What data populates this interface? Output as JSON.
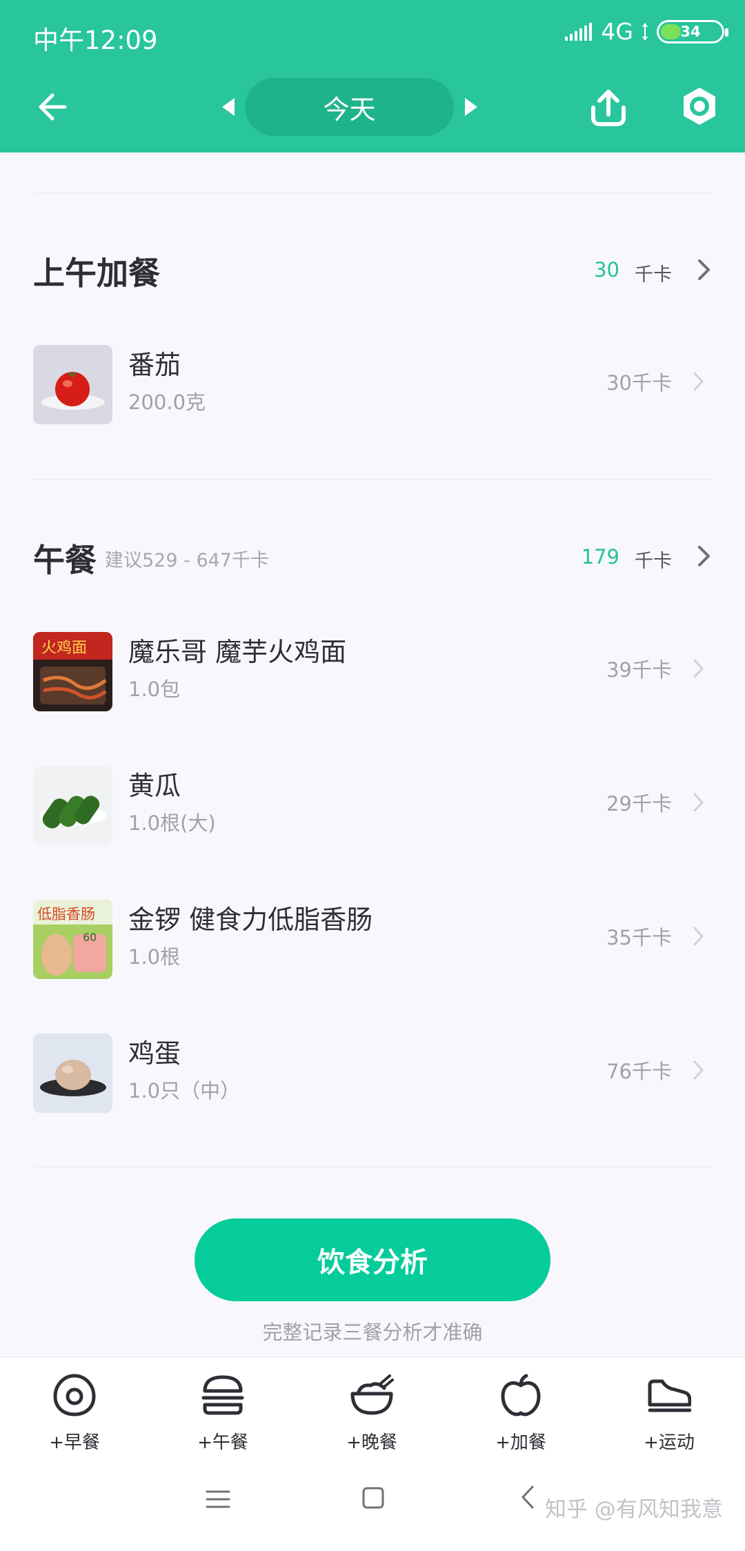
{
  "status_bar": {
    "time": "中午12:09",
    "network": "4G",
    "battery": "34",
    "battery_level": 0.34
  },
  "header": {
    "day_label": "今天",
    "icons": [
      "back-arrow-icon",
      "caret-left-icon",
      "caret-right-icon",
      "share-upload-icon",
      "settings-hexagon-icon"
    ]
  },
  "meals": [
    {
      "title": "上午加餐",
      "hint": "",
      "kcal": "30",
      "kcal_unit": "千卡",
      "foods": [
        {
          "name": "番茄",
          "amount": "200.0克",
          "kcal": "30千卡"
        }
      ]
    },
    {
      "title": "午餐",
      "hint": "建议529 - 647千卡",
      "kcal": "179",
      "kcal_unit": "千卡",
      "foods": [
        {
          "name": "魔乐哥 魔芋火鸡面",
          "amount": "1.0包",
          "kcal": "39千卡"
        },
        {
          "name": "黄瓜",
          "amount": "1.0根(大)",
          "kcal": "29千卡"
        },
        {
          "name": "金锣 健食力低脂香肠",
          "amount": "1.0根",
          "kcal": "35千卡"
        },
        {
          "name": "鸡蛋",
          "amount": "1.0只（中）",
          "kcal": "76千卡"
        }
      ]
    }
  ],
  "analysis": {
    "button_label": "饮食分析",
    "tip": "完整记录三餐分析才准确"
  },
  "bottom_tabs": [
    {
      "label": "+早餐",
      "icon": "egg-icon"
    },
    {
      "label": "+午餐",
      "icon": "burger-icon"
    },
    {
      "label": "+晚餐",
      "icon": "rice-bowl-icon"
    },
    {
      "label": "+加餐",
      "icon": "apple-icon"
    },
    {
      "label": "+运动",
      "icon": "sneaker-icon"
    }
  ],
  "watermark": "知乎 @有风知我意",
  "colors": {
    "header": "#29c59c",
    "accent": "#05cc9a",
    "kcal_accent": "#26c29a"
  }
}
